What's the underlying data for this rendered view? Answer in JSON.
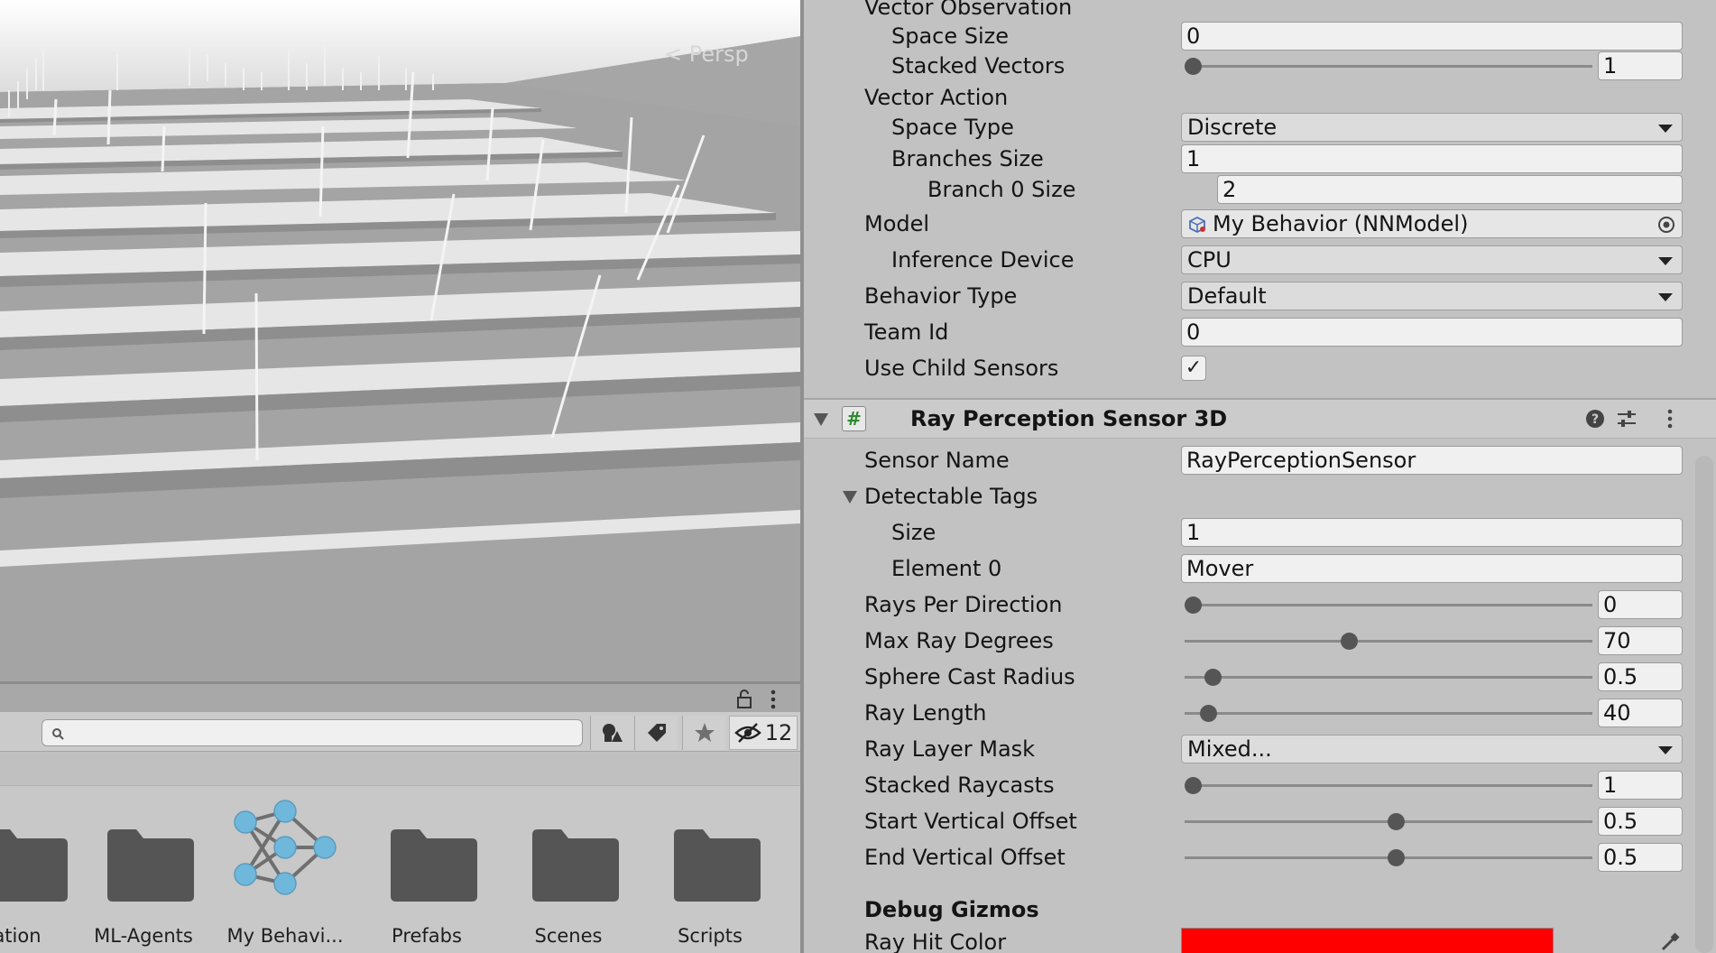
{
  "scene": {
    "camera_label": "Persp"
  },
  "project": {
    "search": {
      "placeholder": ""
    },
    "hidden_count": "12",
    "assets": [
      {
        "label": "ation",
        "icon": "folder-icon"
      },
      {
        "label": "ML-Agents",
        "icon": "folder-icon"
      },
      {
        "label": "My Behavi...",
        "icon": "nnmodel-icon"
      },
      {
        "label": "Prefabs",
        "icon": "folder-icon"
      },
      {
        "label": "Scenes",
        "icon": "folder-icon"
      },
      {
        "label": "Scripts",
        "icon": "folder-icon"
      }
    ]
  },
  "inspector": {
    "vector_observation": {
      "label": "Vector Observation",
      "space_size": {
        "label": "Space Size",
        "value": "0"
      },
      "stacked_vectors": {
        "label": "Stacked Vectors",
        "value": "1",
        "level": 0
      }
    },
    "vector_action": {
      "label": "Vector Action",
      "space_type": {
        "label": "Space Type",
        "value": "Discrete"
      },
      "branches_size": {
        "label": "Branches Size",
        "value": "1"
      },
      "branch0_size": {
        "label": "Branch 0 Size",
        "value": "2"
      }
    },
    "model": {
      "label": "Model",
      "value": "My Behavior (NNModel)"
    },
    "inference_device": {
      "label": "Inference Device",
      "value": "CPU"
    },
    "behavior_type": {
      "label": "Behavior Type",
      "value": "Default"
    },
    "team_id": {
      "label": "Team Id",
      "value": "0"
    },
    "use_child_sensors": {
      "label": "Use Child Sensors",
      "checked": true,
      "check_glyph": "✓"
    },
    "component": {
      "title": "Ray Perception Sensor 3D",
      "hash_glyph": "#"
    },
    "sensor_name": {
      "label": "Sensor Name",
      "value": "RayPerceptionSensor"
    },
    "detectable_tags": {
      "label": "Detectable Tags",
      "size": {
        "label": "Size",
        "value": "1"
      },
      "element0": {
        "label": "Element 0",
        "value": "Mover"
      }
    },
    "rays_per_direction": {
      "label": "Rays Per Direction",
      "value": "0",
      "level": 0
    },
    "max_ray_degrees": {
      "label": "Max Ray Degrees",
      "value": "70",
      "level": 0.4
    },
    "sphere_cast_radius": {
      "label": "Sphere Cast Radius",
      "value": "0.5",
      "level": 0.05
    },
    "ray_length": {
      "label": "Ray Length",
      "value": "40",
      "level": 0.04
    },
    "ray_layer_mask": {
      "label": "Ray Layer Mask",
      "value": "Mixed..."
    },
    "stacked_raycasts": {
      "label": "Stacked Raycasts",
      "value": "1",
      "level": 0
    },
    "start_vertical_offset": {
      "label": "Start Vertical Offset",
      "value": "0.5",
      "level": 0.52
    },
    "end_vertical_offset": {
      "label": "End Vertical Offset",
      "value": "0.5",
      "level": 0.52
    },
    "debug_gizmos": {
      "label": "Debug Gizmos"
    },
    "ray_hit_color": {
      "label": "Ray Hit Color",
      "color": "#ff0000"
    }
  }
}
